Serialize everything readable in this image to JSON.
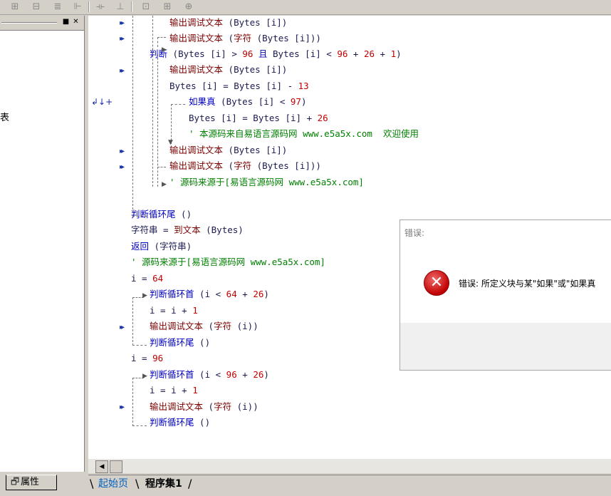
{
  "toolbar": {
    "icons": [
      "align-icon",
      "center-icon",
      "distribute-icon",
      "spacing-icon",
      "width-icon",
      "height-icon",
      "size-icon",
      "grid-icon"
    ]
  },
  "left_panel": {
    "stray_text": "表",
    "props_tab_label": "属性"
  },
  "code": {
    "lines": [
      {
        "segments": [
          [
            "kw",
            "输出调试文本"
          ],
          [
            "dark",
            " (Bytes [i])"
          ]
        ]
      },
      {
        "segments": [
          [
            "kw",
            "输出调试文本"
          ],
          [
            "dark",
            " ("
          ],
          [
            "kw",
            "字符"
          ],
          [
            "dark",
            " (Bytes [i]))"
          ]
        ]
      },
      {
        "segments": [
          [
            "blue",
            "判断"
          ],
          [
            "dark",
            " (Bytes [i] > "
          ],
          [
            "red",
            "96"
          ],
          [
            "dark",
            " "
          ],
          [
            "blue",
            "且"
          ],
          [
            "dark",
            " Bytes [i] < "
          ],
          [
            "red",
            "96"
          ],
          [
            "dark",
            " + "
          ],
          [
            "red",
            "26"
          ],
          [
            "dark",
            " + "
          ],
          [
            "red",
            "1"
          ],
          [
            "dark",
            ")"
          ]
        ]
      },
      {
        "segments": [
          [
            "kw",
            "输出调试文本"
          ],
          [
            "dark",
            " (Bytes [i])"
          ]
        ]
      },
      {
        "segments": [
          [
            "dark",
            "Bytes [i] = Bytes [i] - "
          ],
          [
            "red",
            "13"
          ]
        ]
      },
      {
        "segments": [
          [
            "blue",
            "如果真"
          ],
          [
            "dark",
            " (Bytes [i] < "
          ],
          [
            "red",
            "97"
          ],
          [
            "dark",
            ")"
          ]
        ]
      },
      {
        "segments": [
          [
            "dark",
            "Bytes [i] = Bytes [i] + "
          ],
          [
            "red",
            "26"
          ]
        ]
      },
      {
        "segments": [
          [
            "green",
            "' 本源码来自易语言源码网 www.e5a5x.com  欢迎使用"
          ]
        ]
      },
      {
        "segments": [
          [
            "kw",
            "输出调试文本"
          ],
          [
            "dark",
            " (Bytes [i])"
          ]
        ]
      },
      {
        "segments": [
          [
            "kw",
            "输出调试文本"
          ],
          [
            "dark",
            " ("
          ],
          [
            "kw",
            "字符"
          ],
          [
            "dark",
            " (Bytes [i]))"
          ]
        ]
      },
      {
        "segments": [
          [
            "green",
            "' 源码来源于[易语言源码网 www.e5a5x.com]"
          ]
        ]
      },
      {
        "segments": []
      },
      {
        "segments": [
          [
            "blue",
            "判断循环尾"
          ],
          [
            "dark",
            " ()"
          ]
        ]
      },
      {
        "segments": [
          [
            "dark",
            "字符串 = "
          ],
          [
            "kw",
            "到文本"
          ],
          [
            "dark",
            " (Bytes)"
          ]
        ]
      },
      {
        "segments": [
          [
            "blue",
            "返回"
          ],
          [
            "dark",
            " (字符串)"
          ]
        ]
      },
      {
        "segments": [
          [
            "green",
            "' 源码来源于[易语言源码网 www.e5a5x.com]"
          ]
        ]
      },
      {
        "segments": [
          [
            "dark",
            "i = "
          ],
          [
            "red",
            "64"
          ]
        ]
      },
      {
        "segments": [
          [
            "blue",
            "判断循环首"
          ],
          [
            "dark",
            " (i < "
          ],
          [
            "red",
            "64"
          ],
          [
            "dark",
            " + "
          ],
          [
            "red",
            "26"
          ],
          [
            "dark",
            ")"
          ]
        ]
      },
      {
        "segments": [
          [
            "dark",
            "i = i + "
          ],
          [
            "red",
            "1"
          ]
        ]
      },
      {
        "segments": [
          [
            "kw",
            "输出调试文本"
          ],
          [
            "dark",
            " ("
          ],
          [
            "kw",
            "字符"
          ],
          [
            "dark",
            " (i))"
          ]
        ]
      },
      {
        "segments": [
          [
            "blue",
            "判断循环尾"
          ],
          [
            "dark",
            " ()"
          ]
        ]
      },
      {
        "segments": [
          [
            "dark",
            "i = "
          ],
          [
            "red",
            "96"
          ]
        ]
      },
      {
        "segments": [
          [
            "blue",
            "判断循环首"
          ],
          [
            "dark",
            " (i < "
          ],
          [
            "red",
            "96"
          ],
          [
            "dark",
            " + "
          ],
          [
            "red",
            "26"
          ],
          [
            "dark",
            ")"
          ]
        ]
      },
      {
        "segments": [
          [
            "dark",
            "i = i + "
          ],
          [
            "red",
            "1"
          ]
        ]
      },
      {
        "segments": [
          [
            "kw",
            "输出调试文本"
          ],
          [
            "dark",
            " ("
          ],
          [
            "kw",
            "字符"
          ],
          [
            "dark",
            " (i))"
          ]
        ]
      },
      {
        "segments": [
          [
            "blue",
            "判断循环尾"
          ],
          [
            "dark",
            " ()"
          ]
        ]
      }
    ]
  },
  "dialog": {
    "title": "错误:",
    "message": "错误: 所定义块与某\"如果\"或\"如果真"
  },
  "tabs": {
    "start_page": "起始页",
    "program_set": "程序集1"
  },
  "colors": {
    "keyword": "#7a0000",
    "flow": "#0000c0",
    "comment": "#008000",
    "number": "#c00000"
  }
}
